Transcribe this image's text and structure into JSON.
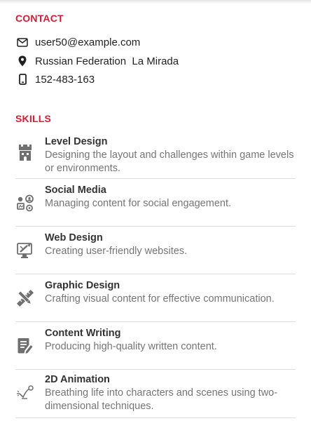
{
  "contact": {
    "heading": "CONTACT",
    "email": "user50@example.com",
    "location": "Russian Federation  La Mirada",
    "phone": "152-483-163"
  },
  "skills": {
    "heading": "SKILLS",
    "items": [
      {
        "title": "Level Design",
        "desc": "Designing the layout and challenges within game levels or environments.",
        "icon": "castle-icon"
      },
      {
        "title": "Social Media",
        "desc": "Managing content for social engagement.",
        "icon": "social-network-icon"
      },
      {
        "title": "Web Design",
        "desc": "Creating user-friendly websites.",
        "icon": "web-design-icon"
      },
      {
        "title": "Graphic Design",
        "desc": "Crafting visual content for effective communication.",
        "icon": "pencil-ruler-icon"
      },
      {
        "title": "Content Writing",
        "desc": "Producing high-quality written content.",
        "icon": "document-pen-icon"
      },
      {
        "title": "2D Animation",
        "desc": "Breathing life into characters and scenes using two-dimensional techniques.",
        "icon": "animation-icon"
      }
    ]
  },
  "colors": {
    "accent": "#d81b35",
    "icon": "#6f6f6f",
    "muted_text": "#757575"
  }
}
